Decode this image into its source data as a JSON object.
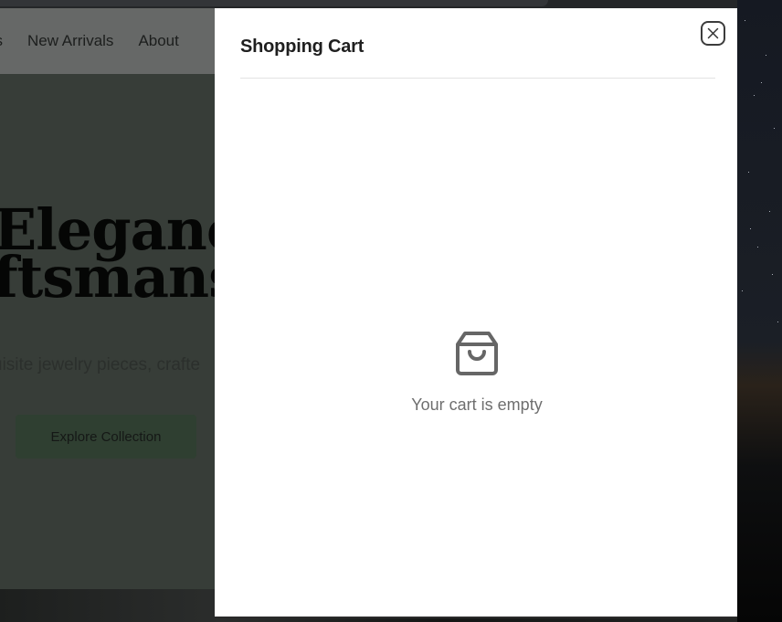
{
  "nav": {
    "items": [
      {
        "label": "ns"
      },
      {
        "label": "New Arrivals"
      },
      {
        "label": "About"
      }
    ]
  },
  "hero": {
    "title_line1": "Eleganc",
    "title_line2": "ftsmans",
    "subtitle": "uisite jewelry pieces, crafte",
    "cta_label": "Explore Collection"
  },
  "cart": {
    "title": "Shopping Cart",
    "close_icon": "close-icon",
    "empty_icon": "shopping-bag-icon",
    "empty_message": "Your cart is empty"
  },
  "colors": {
    "overlay": "#3a3f3b",
    "drawer_bg": "#ffffff",
    "muted_text": "#6e6e6e",
    "icon_color": "#666666"
  }
}
